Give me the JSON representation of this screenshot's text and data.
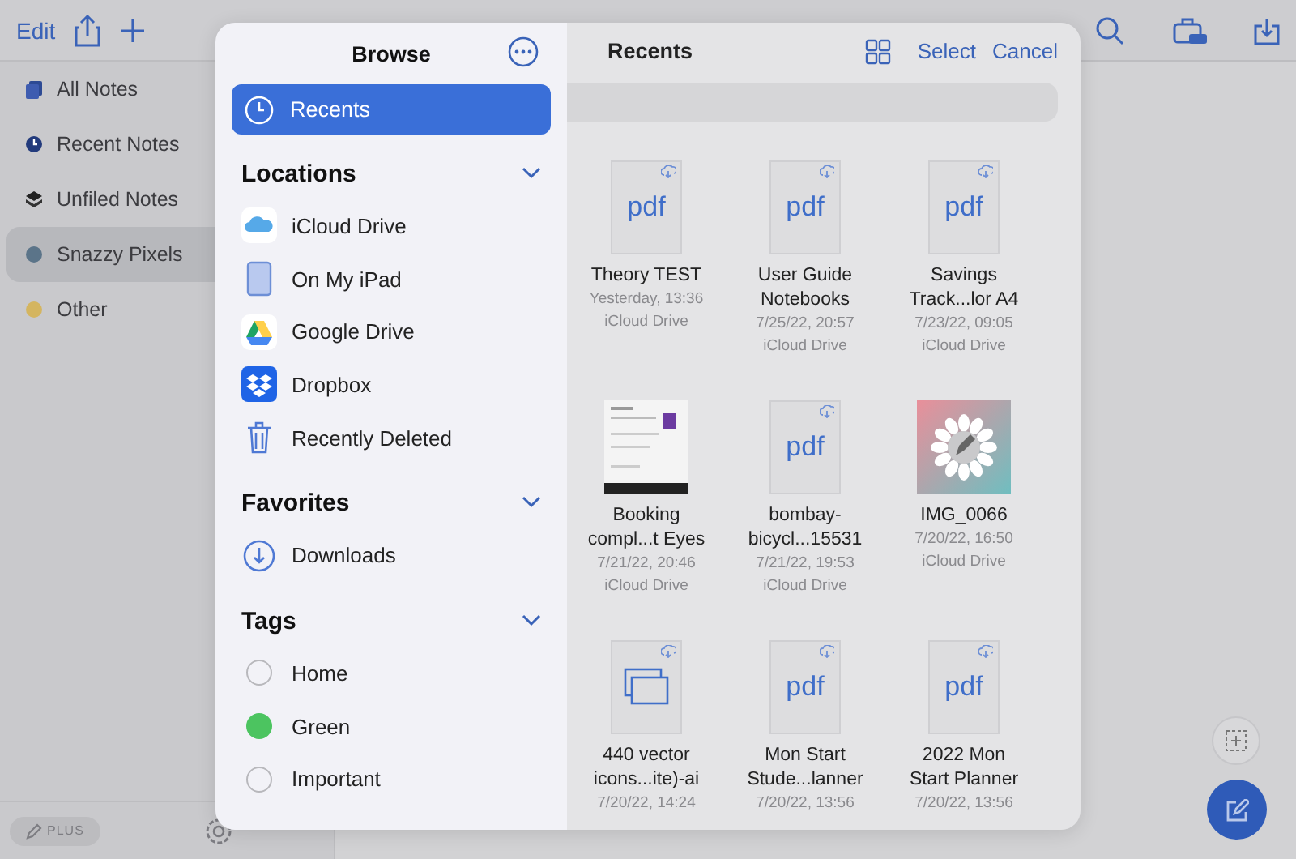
{
  "toolbar": {
    "edit": "Edit"
  },
  "sidebar": {
    "items": [
      {
        "kind": "all",
        "label": "All Notes",
        "selected": false
      },
      {
        "kind": "recent",
        "label": "Recent Notes",
        "selected": false
      },
      {
        "kind": "unfiled",
        "label": "Unfiled Notes",
        "selected": false
      },
      {
        "kind": "folder",
        "label": "Snazzy Pixels",
        "color": "#5b7489",
        "selected": true
      },
      {
        "kind": "folder",
        "label": "Other",
        "color": "#d4b560",
        "selected": false
      }
    ],
    "plus_badge": "PLUS"
  },
  "browse": {
    "title": "Browse",
    "recents": {
      "label": "Recents",
      "selected": true
    },
    "sections": [
      {
        "title": "Locations",
        "expanded": true,
        "items": [
          {
            "kind": "icloud",
            "label": "iCloud Drive"
          },
          {
            "kind": "ipad",
            "label": "On My iPad"
          },
          {
            "kind": "gdrive",
            "label": "Google Drive"
          },
          {
            "kind": "dropbox",
            "label": "Dropbox"
          },
          {
            "kind": "trash",
            "label": "Recently Deleted"
          }
        ]
      },
      {
        "title": "Favorites",
        "expanded": true,
        "items": [
          {
            "kind": "downloads",
            "label": "Downloads"
          }
        ]
      },
      {
        "title": "Tags",
        "expanded": true,
        "items": [
          {
            "kind": "tag",
            "label": "Home"
          },
          {
            "kind": "tag",
            "label": "Green",
            "color": "#4cc460"
          },
          {
            "kind": "tag",
            "label": "Important"
          }
        ]
      }
    ]
  },
  "recents": {
    "title": "Recents",
    "actions": [
      "Select",
      "Cancel"
    ],
    "files": [
      {
        "kind": "pdf",
        "thumb_label": "pdf",
        "cloud": true,
        "name_lines": [
          "Theory TEST"
        ],
        "date": "Yesterday, 13:36",
        "location": "iCloud Drive"
      },
      {
        "kind": "pdf",
        "thumb_label": "pdf",
        "cloud": true,
        "name_lines": [
          "User Guide",
          "Notebooks"
        ],
        "date": "7/25/22, 20:57",
        "location": "iCloud Drive"
      },
      {
        "kind": "pdf",
        "thumb_label": "pdf",
        "cloud": true,
        "name_lines": [
          "Savings",
          "Track...lor A4"
        ],
        "date": "7/23/22, 09:05",
        "location": "iCloud Drive"
      },
      {
        "kind": "screenshot",
        "cloud": false,
        "name_lines": [
          "Booking",
          "compl...t Eyes"
        ],
        "date": "7/21/22, 20:46",
        "location": "iCloud Drive"
      },
      {
        "kind": "pdf",
        "thumb_label": "pdf",
        "cloud": true,
        "name_lines": [
          "bombay-",
          "bicycl...15531"
        ],
        "date": "7/21/22, 19:53",
        "location": "iCloud Drive"
      },
      {
        "kind": "app-image",
        "cloud": false,
        "name_lines": [
          "IMG_0066"
        ],
        "date": "7/20/22, 16:50",
        "location": "iCloud Drive"
      },
      {
        "kind": "stack",
        "cloud": true,
        "name_lines": [
          "440 vector",
          "icons...ite)-ai"
        ],
        "date": "7/20/22, 14:24"
      },
      {
        "kind": "pdf",
        "thumb_label": "pdf",
        "cloud": true,
        "name_lines": [
          "Mon Start",
          "Stude...lanner"
        ],
        "date": "7/20/22, 13:56"
      },
      {
        "kind": "pdf",
        "thumb_label": "pdf",
        "cloud": true,
        "name_lines": [
          "2022 Mon",
          "Start Planner"
        ],
        "date": "7/20/22, 13:56"
      }
    ]
  }
}
